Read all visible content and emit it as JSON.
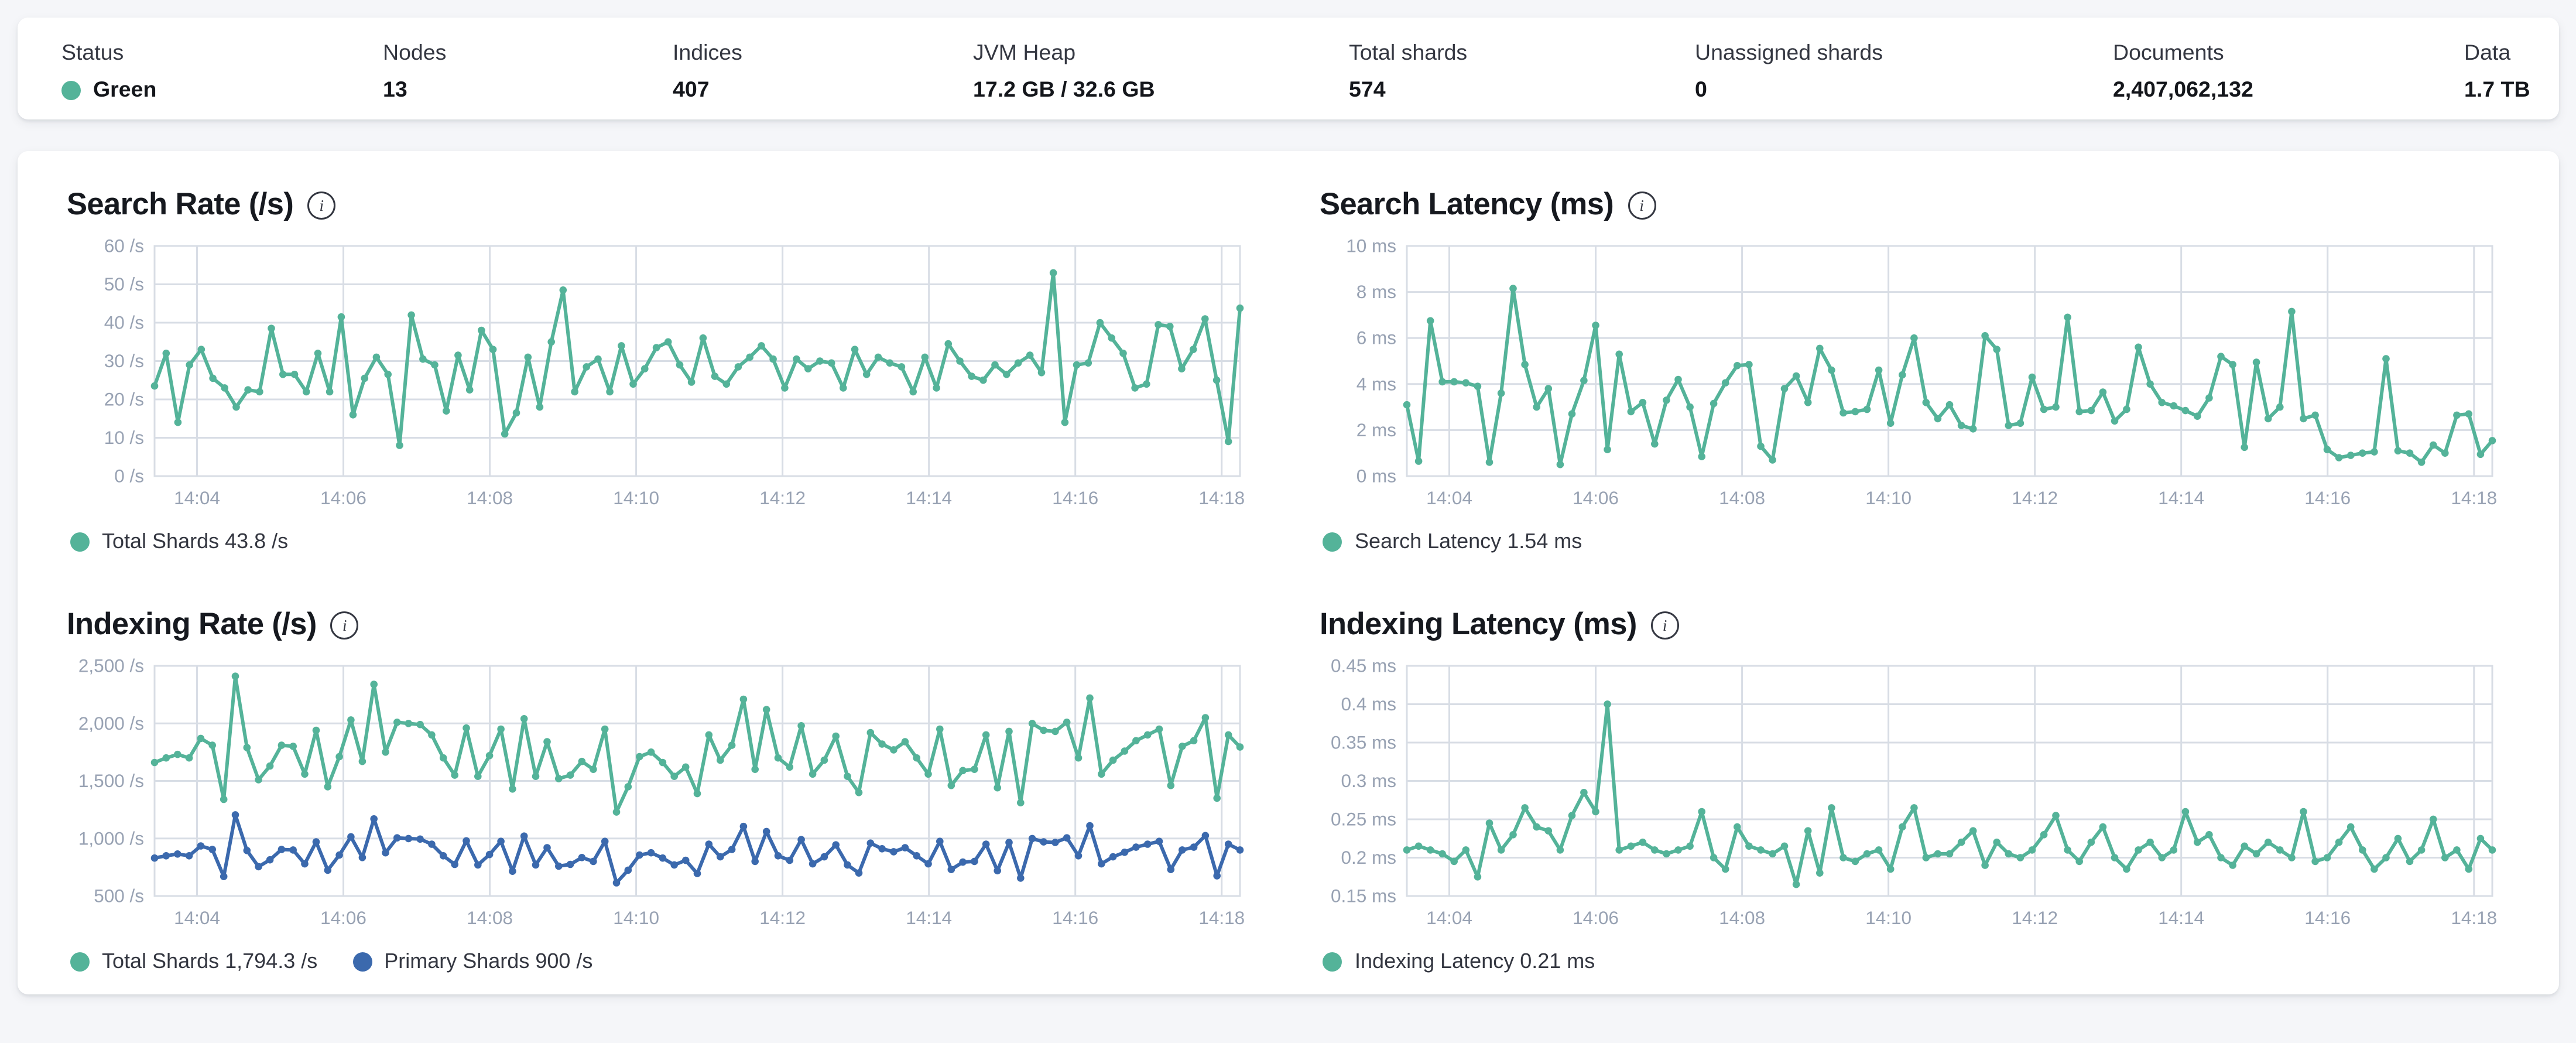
{
  "colors": {
    "teal": "#54B399",
    "blue": "#3B69AD",
    "grid": "#D8DDE5",
    "axis_text": "#98A2B3"
  },
  "header": {
    "stats": [
      {
        "label": "Status",
        "value": "Green",
        "has_dot": true
      },
      {
        "label": "Nodes",
        "value": "13"
      },
      {
        "label": "Indices",
        "value": "407"
      },
      {
        "label": "JVM Heap",
        "value": "17.2 GB / 32.6 GB"
      },
      {
        "label": "Total shards",
        "value": "574"
      },
      {
        "label": "Unassigned shards",
        "value": "0"
      },
      {
        "label": "Documents",
        "value": "2,407,062,132"
      },
      {
        "label": "Data",
        "value": "1.7 TB"
      }
    ]
  },
  "chart_data": [
    {
      "id": "search-rate",
      "type": "line",
      "title": "Search Rate (/s)",
      "ylim": [
        0,
        60
      ],
      "y_ticks": [
        {
          "v": 0,
          "label": "0 /s"
        },
        {
          "v": 10,
          "label": "10 /s"
        },
        {
          "v": 20,
          "label": "20 /s"
        },
        {
          "v": 30,
          "label": "30 /s"
        },
        {
          "v": 40,
          "label": "40 /s"
        },
        {
          "v": 50,
          "label": "50 /s"
        },
        {
          "v": 60,
          "label": "60 /s"
        }
      ],
      "x_range_minutes": [
        3.42,
        18.25
      ],
      "x_ticks": [
        {
          "t": 4,
          "label": "14:04"
        },
        {
          "t": 6,
          "label": "14:06"
        },
        {
          "t": 8,
          "label": "14:08"
        },
        {
          "t": 10,
          "label": "14:10"
        },
        {
          "t": 12,
          "label": "14:12"
        },
        {
          "t": 14,
          "label": "14:14"
        },
        {
          "t": 16,
          "label": "14:16"
        },
        {
          "t": 18,
          "label": "14:18"
        }
      ],
      "series": [
        {
          "name": "Total Shards",
          "legend_label": "Total Shards 43.8 /s",
          "color": "#54B399",
          "values": [
            23.5,
            32,
            14,
            29,
            33,
            25.5,
            23,
            18,
            22.5,
            22,
            38.5,
            26.5,
            26.5,
            22,
            32,
            22,
            41.5,
            16,
            25.5,
            31,
            26.5,
            8,
            42,
            30.5,
            29,
            17,
            31.5,
            22.5,
            38,
            33,
            11,
            16.5,
            31,
            18,
            35,
            48.5,
            22,
            28.5,
            30.5,
            22,
            34,
            24,
            28,
            33.5,
            35,
            29,
            24.5,
            36,
            26,
            24,
            28.5,
            31,
            34,
            30.5,
            23,
            30.5,
            28,
            30,
            29.5,
            23,
            33,
            26.5,
            31,
            29.5,
            28.5,
            22,
            31,
            23,
            34.5,
            30,
            26,
            25,
            29,
            26.5,
            29.5,
            31.5,
            27,
            53,
            14,
            29,
            29.5,
            40,
            36,
            32,
            23,
            24,
            39.5,
            39,
            28,
            33,
            41,
            25,
            9,
            43.8
          ]
        }
      ]
    },
    {
      "id": "search-latency",
      "type": "line",
      "title": "Search Latency (ms)",
      "ylim": [
        0,
        10
      ],
      "y_ticks": [
        {
          "v": 0,
          "label": "0 ms"
        },
        {
          "v": 2,
          "label": "2 ms"
        },
        {
          "v": 4,
          "label": "4 ms"
        },
        {
          "v": 6,
          "label": "6 ms"
        },
        {
          "v": 8,
          "label": "8 ms"
        },
        {
          "v": 10,
          "label": "10 ms"
        }
      ],
      "x_range_minutes": [
        3.42,
        18.25
      ],
      "x_ticks": [
        {
          "t": 4,
          "label": "14:04"
        },
        {
          "t": 6,
          "label": "14:06"
        },
        {
          "t": 8,
          "label": "14:08"
        },
        {
          "t": 10,
          "label": "14:10"
        },
        {
          "t": 12,
          "label": "14:12"
        },
        {
          "t": 14,
          "label": "14:14"
        },
        {
          "t": 16,
          "label": "14:16"
        },
        {
          "t": 18,
          "label": "14:18"
        }
      ],
      "series": [
        {
          "name": "Search Latency",
          "legend_label": "Search Latency 1.54 ms",
          "color": "#54B399",
          "values": [
            3.1,
            0.65,
            6.75,
            4.1,
            4.1,
            4.05,
            3.9,
            0.6,
            3.6,
            8.15,
            4.85,
            3.0,
            3.8,
            0.5,
            2.7,
            4.15,
            6.55,
            1.15,
            5.3,
            2.8,
            3.2,
            1.4,
            3.3,
            4.2,
            3.0,
            0.85,
            3.15,
            4.05,
            4.8,
            4.85,
            1.3,
            0.7,
            3.8,
            4.35,
            3.2,
            5.55,
            4.6,
            2.75,
            2.8,
            2.9,
            4.6,
            2.3,
            4.4,
            6.0,
            3.2,
            2.5,
            3.1,
            2.2,
            2.05,
            6.1,
            5.5,
            2.2,
            2.3,
            4.3,
            2.9,
            3.0,
            6.9,
            2.8,
            2.85,
            3.65,
            2.4,
            2.9,
            5.6,
            4.0,
            3.2,
            3.05,
            2.85,
            2.6,
            3.4,
            5.2,
            4.85,
            1.25,
            4.95,
            2.5,
            3.0,
            7.15,
            2.5,
            2.65,
            1.15,
            0.8,
            0.9,
            1.0,
            1.05,
            5.1,
            1.1,
            1.0,
            0.6,
            1.35,
            1.0,
            2.65,
            2.7,
            0.95,
            1.54
          ]
        }
      ]
    },
    {
      "id": "indexing-rate",
      "type": "line",
      "title": "Indexing Rate (/s)",
      "ylim": [
        500,
        2500
      ],
      "y_ticks": [
        {
          "v": 500,
          "label": "500 /s"
        },
        {
          "v": 1000,
          "label": "1,000 /s"
        },
        {
          "v": 1500,
          "label": "1,500 /s"
        },
        {
          "v": 2000,
          "label": "2,000 /s"
        },
        {
          "v": 2500,
          "label": "2,500 /s"
        }
      ],
      "x_range_minutes": [
        3.42,
        18.25
      ],
      "x_ticks": [
        {
          "t": 4,
          "label": "14:04"
        },
        {
          "t": 6,
          "label": "14:06"
        },
        {
          "t": 8,
          "label": "14:08"
        },
        {
          "t": 10,
          "label": "14:10"
        },
        {
          "t": 12,
          "label": "14:12"
        },
        {
          "t": 14,
          "label": "14:14"
        },
        {
          "t": 16,
          "label": "14:16"
        },
        {
          "t": 18,
          "label": "14:18"
        }
      ],
      "series": [
        {
          "name": "Total Shards",
          "legend_label": "Total Shards 1,794.3 /s",
          "color": "#54B399",
          "values": [
            1660,
            1700,
            1730,
            1700,
            1870,
            1810,
            1340,
            2410,
            1790,
            1510,
            1630,
            1810,
            1800,
            1560,
            1940,
            1450,
            1710,
            2030,
            1670,
            2340,
            1750,
            2010,
            2000,
            1990,
            1900,
            1700,
            1550,
            1960,
            1540,
            1720,
            1950,
            1430,
            2040,
            1540,
            1840,
            1520,
            1550,
            1670,
            1600,
            1950,
            1230,
            1450,
            1710,
            1750,
            1660,
            1540,
            1620,
            1390,
            1900,
            1680,
            1810,
            2210,
            1600,
            2120,
            1700,
            1620,
            1980,
            1560,
            1680,
            1890,
            1540,
            1400,
            1920,
            1820,
            1770,
            1840,
            1700,
            1560,
            1950,
            1460,
            1590,
            1600,
            1900,
            1440,
            1930,
            1310,
            2000,
            1940,
            1930,
            2010,
            1700,
            2220,
            1560,
            1680,
            1760,
            1850,
            1900,
            1950,
            1460,
            1800,
            1850,
            2050,
            1350,
            1900,
            1794.3
          ]
        },
        {
          "name": "Primary Shards",
          "legend_label": "Primary Shards 900 /s",
          "color": "#3B69AD",
          "values": [
            830,
            850,
            865,
            850,
            935,
            905,
            670,
            1205,
            895,
            755,
            815,
            905,
            900,
            780,
            970,
            725,
            855,
            1015,
            835,
            1170,
            875,
            1005,
            1000,
            995,
            950,
            850,
            775,
            980,
            770,
            860,
            975,
            715,
            1020,
            770,
            920,
            760,
            775,
            835,
            800,
            975,
            615,
            725,
            855,
            875,
            830,
            770,
            810,
            695,
            950,
            840,
            905,
            1105,
            800,
            1060,
            850,
            810,
            990,
            780,
            840,
            945,
            770,
            700,
            960,
            910,
            885,
            920,
            850,
            780,
            975,
            730,
            795,
            800,
            950,
            720,
            965,
            655,
            1000,
            970,
            965,
            1005,
            850,
            1110,
            780,
            840,
            880,
            925,
            950,
            975,
            730,
            900,
            925,
            1025,
            675,
            950,
            900
          ]
        }
      ]
    },
    {
      "id": "indexing-latency",
      "type": "line",
      "title": "Indexing Latency (ms)",
      "ylim": [
        0.15,
        0.45
      ],
      "y_ticks": [
        {
          "v": 0.15,
          "label": "0.15 ms"
        },
        {
          "v": 0.2,
          "label": "0.2 ms"
        },
        {
          "v": 0.25,
          "label": "0.25 ms"
        },
        {
          "v": 0.3,
          "label": "0.3 ms"
        },
        {
          "v": 0.35,
          "label": "0.35 ms"
        },
        {
          "v": 0.4,
          "label": "0.4 ms"
        },
        {
          "v": 0.45,
          "label": "0.45 ms"
        }
      ],
      "x_range_minutes": [
        3.42,
        18.25
      ],
      "x_ticks": [
        {
          "t": 4,
          "label": "14:04"
        },
        {
          "t": 6,
          "label": "14:06"
        },
        {
          "t": 8,
          "label": "14:08"
        },
        {
          "t": 10,
          "label": "14:10"
        },
        {
          "t": 12,
          "label": "14:12"
        },
        {
          "t": 14,
          "label": "14:14"
        },
        {
          "t": 16,
          "label": "14:16"
        },
        {
          "t": 18,
          "label": "14:18"
        }
      ],
      "series": [
        {
          "name": "Indexing Latency",
          "legend_label": "Indexing Latency 0.21 ms",
          "color": "#54B399",
          "values": [
            0.21,
            0.215,
            0.21,
            0.205,
            0.195,
            0.21,
            0.175,
            0.245,
            0.21,
            0.23,
            0.265,
            0.24,
            0.235,
            0.21,
            0.255,
            0.285,
            0.26,
            0.4,
            0.21,
            0.215,
            0.22,
            0.21,
            0.205,
            0.21,
            0.215,
            0.26,
            0.2,
            0.185,
            0.24,
            0.215,
            0.21,
            0.205,
            0.215,
            0.165,
            0.235,
            0.18,
            0.265,
            0.2,
            0.195,
            0.205,
            0.21,
            0.185,
            0.24,
            0.265,
            0.2,
            0.205,
            0.205,
            0.22,
            0.235,
            0.19,
            0.22,
            0.205,
            0.2,
            0.21,
            0.23,
            0.255,
            0.21,
            0.195,
            0.22,
            0.24,
            0.2,
            0.185,
            0.21,
            0.22,
            0.2,
            0.21,
            0.26,
            0.22,
            0.23,
            0.2,
            0.19,
            0.215,
            0.205,
            0.22,
            0.21,
            0.2,
            0.26,
            0.195,
            0.2,
            0.22,
            0.24,
            0.21,
            0.185,
            0.2,
            0.225,
            0.195,
            0.21,
            0.25,
            0.2,
            0.21,
            0.185,
            0.225,
            0.21
          ]
        }
      ]
    }
  ]
}
